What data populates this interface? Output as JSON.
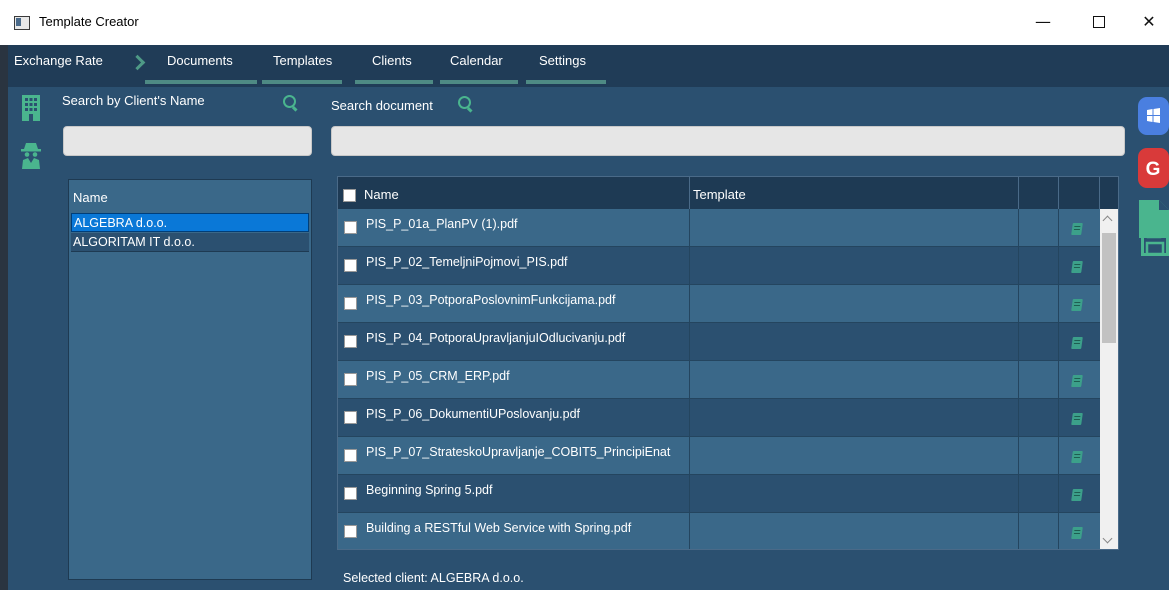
{
  "window": {
    "title": "Template Creator",
    "min_glyph": "—",
    "close_glyph": "✕"
  },
  "menu": {
    "items": [
      "Exchange Rate",
      "Documents",
      "Templates",
      "Clients",
      "Calendar",
      "Settings"
    ]
  },
  "search": {
    "client_label": "Search by  Client's Name",
    "client_value": "",
    "document_label": "Search document",
    "document_value": ""
  },
  "clients": {
    "header": "Name",
    "items": [
      {
        "name": "ALGEBRA d.o.o.",
        "selected": true
      },
      {
        "name": "ALGORITAM IT d.o.o.",
        "selected": false
      }
    ]
  },
  "documents": {
    "headers": {
      "name": "Name",
      "template": "Template"
    },
    "rows": [
      {
        "name": "PIS_P_01a_PlanPV (1).pdf",
        "template": ""
      },
      {
        "name": "PIS_P_02_TemeljniPojmovi_PIS.pdf",
        "template": ""
      },
      {
        "name": "PIS_P_03_PotporaPoslovnimFunkcijama.pdf",
        "template": ""
      },
      {
        "name": "PIS_P_04_PotporaUpravljanjuIOdlucivanju.pdf",
        "template": ""
      },
      {
        "name": "PIS_P_05_CRM_ERP.pdf",
        "template": ""
      },
      {
        "name": "PIS_P_06_DokumentiUPoslovanju.pdf",
        "template": ""
      },
      {
        "name": "PIS_P_07_StrateskoUpravljanje_COBIT5_PrincipiEnat",
        "template": ""
      },
      {
        "name": "Beginning Spring 5.pdf",
        "template": ""
      },
      {
        "name": "Building a RESTful Web Service with Spring.pdf",
        "template": ""
      }
    ]
  },
  "status": {
    "selected_client": "Selected client: ALGEBRA d.o.o."
  },
  "icons": {
    "left": [
      "building-icon",
      "spy-icon"
    ],
    "right": [
      "windows-icon",
      "google-icon",
      "document-icon",
      "save-icon"
    ],
    "google_letter": "G"
  },
  "colors": {
    "background": "#2b5070",
    "menubar": "#203c57",
    "accent": "#4ab58e",
    "selection": "#0a78d7"
  }
}
